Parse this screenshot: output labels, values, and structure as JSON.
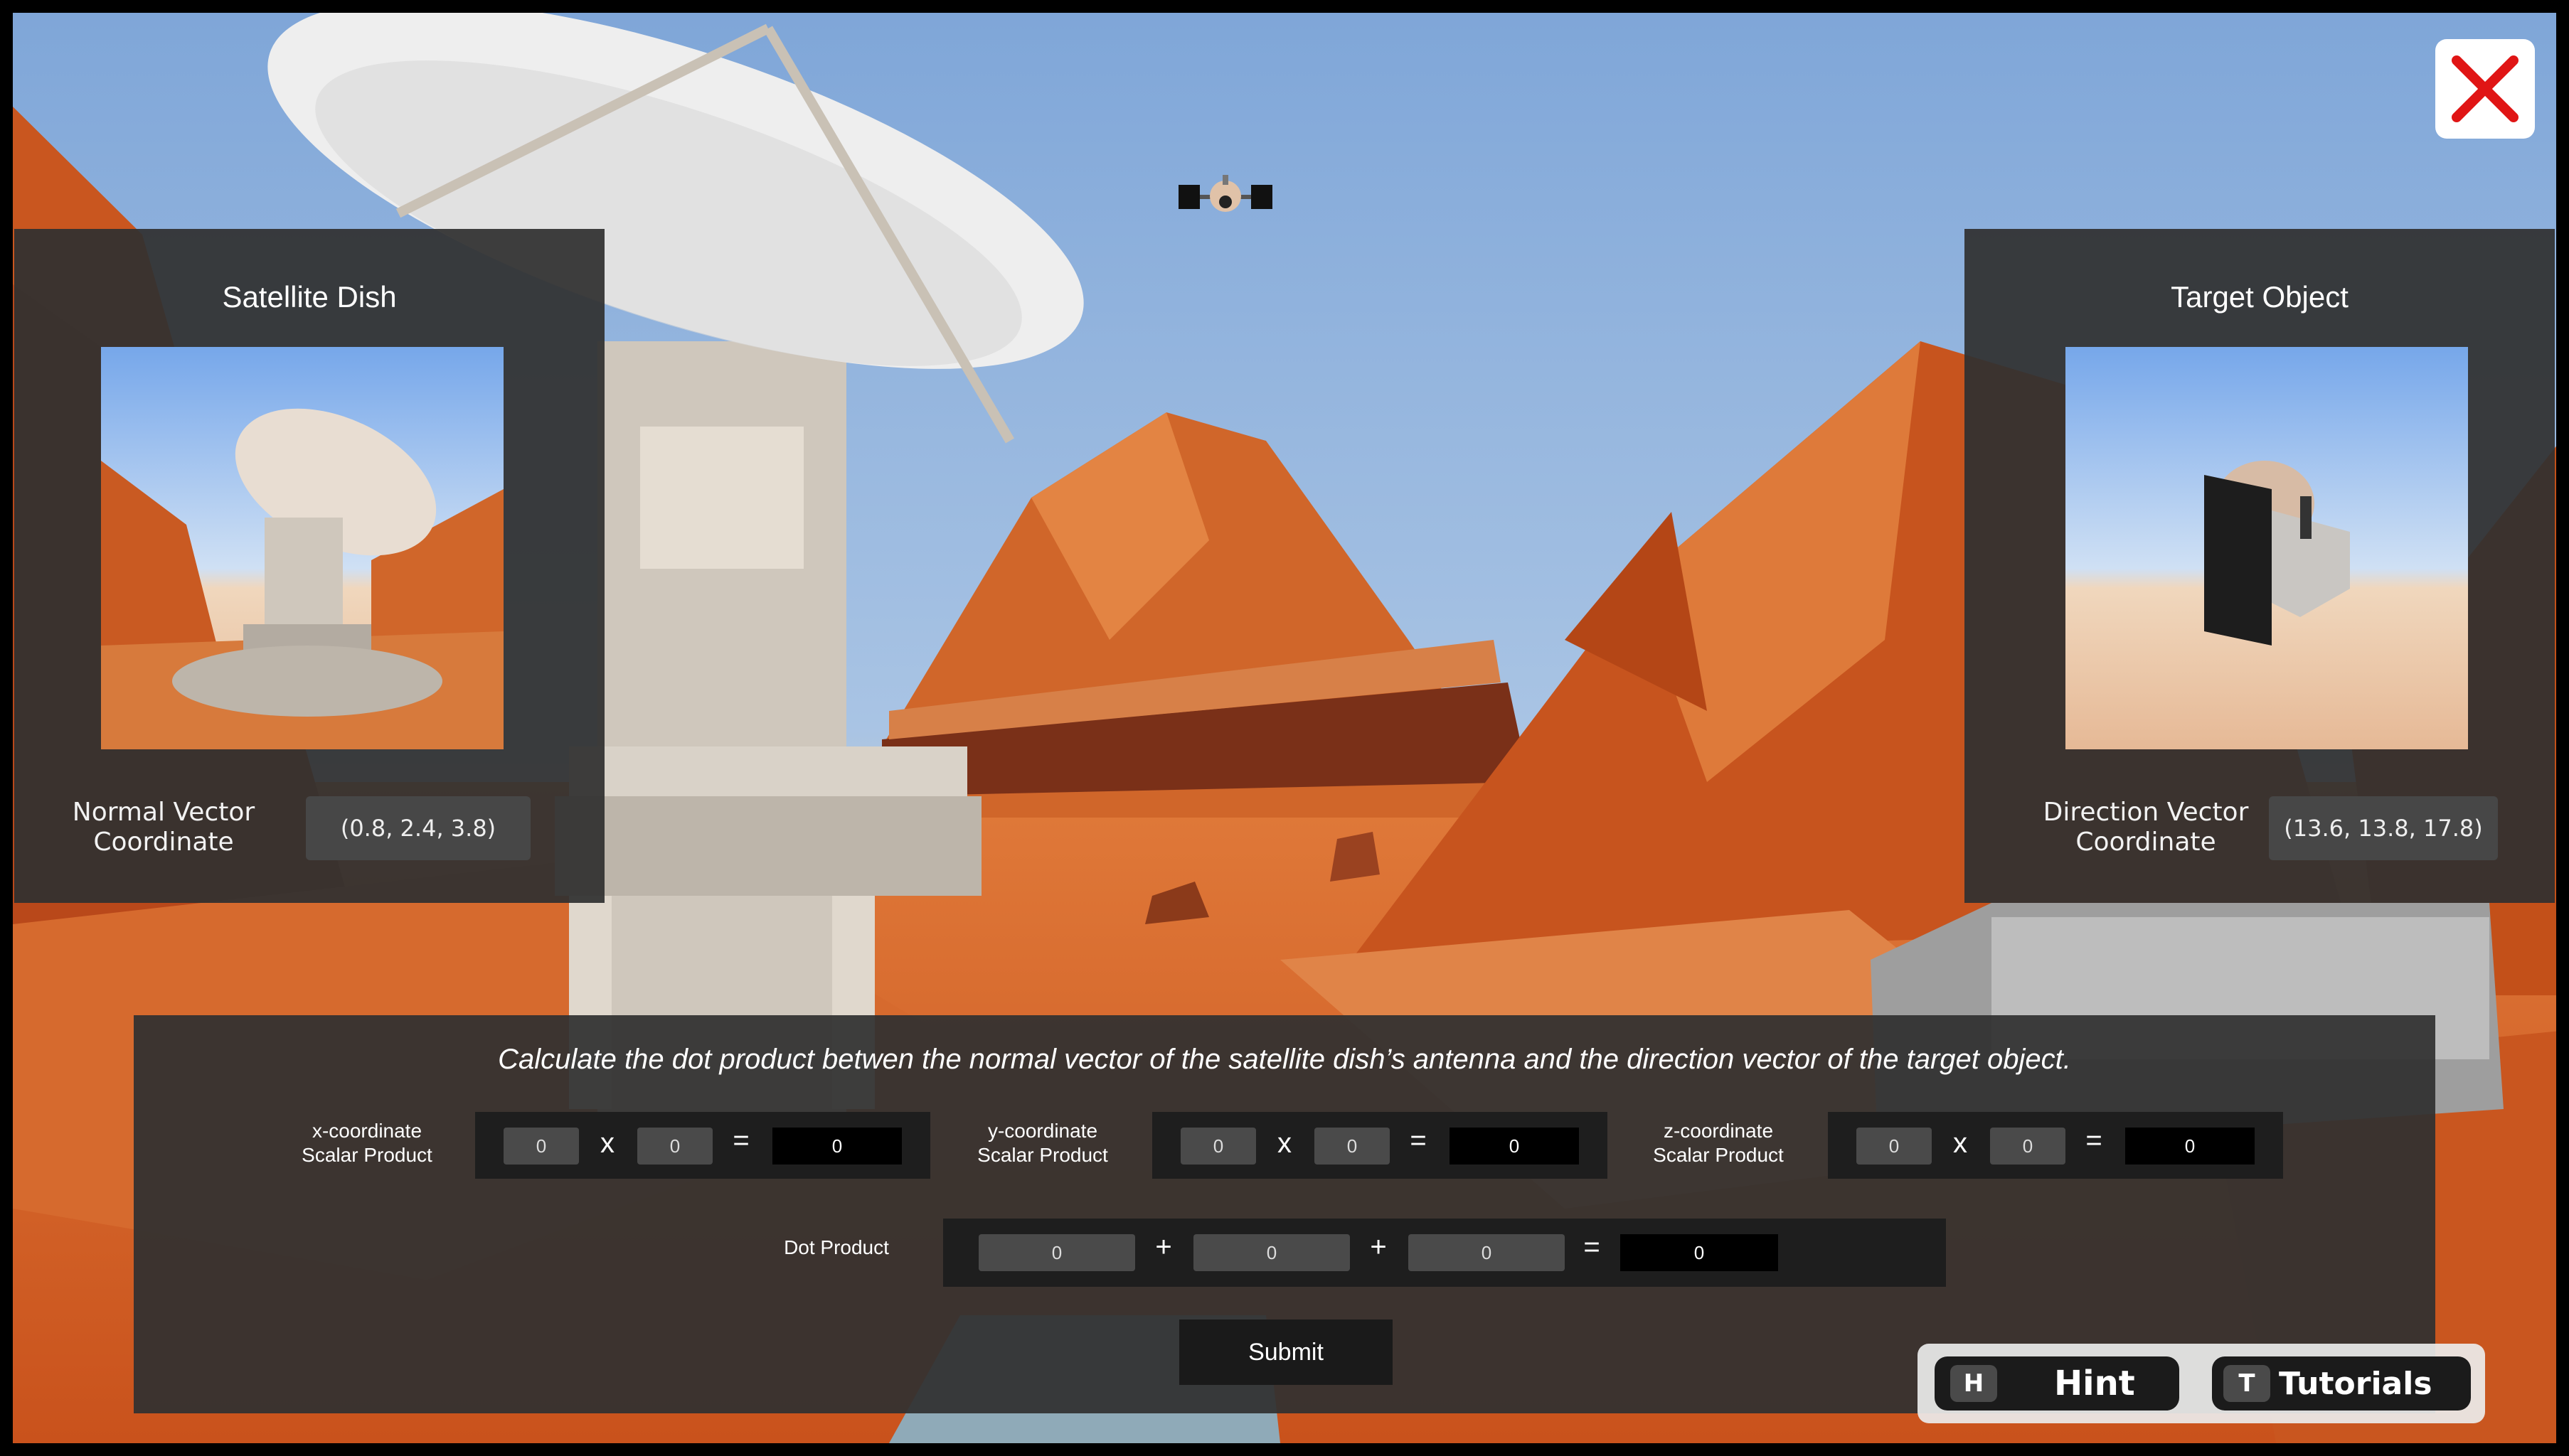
{
  "left_panel": {
    "title": "Satellite Dish",
    "vector_label_line1": "Normal Vector",
    "vector_label_line2": "Coordinate",
    "vector_value": "(0.8, 2.4, 3.8)"
  },
  "right_panel": {
    "title": "Target Object",
    "vector_label_line1": "Direction Vector",
    "vector_label_line2": "Coordinate",
    "vector_value": "(13.6, 13.8, 17.8)"
  },
  "question": {
    "text": "Calculate the dot product betwen the normal vector of the satellite dish’s antenna and the direction vector of the target object."
  },
  "scalar_rows": [
    {
      "label_line1": "x-coordinate",
      "label_line2": "Scalar Product",
      "a": "0",
      "b": "0",
      "result": "0"
    },
    {
      "label_line1": "y-coordinate",
      "label_line2": "Scalar Product",
      "a": "0",
      "b": "0",
      "result": "0"
    },
    {
      "label_line1": "z-coordinate",
      "label_line2": "Scalar Product",
      "a": "0",
      "b": "0",
      "result": "0"
    }
  ],
  "operators": {
    "times": "x",
    "equals": "=",
    "plus": "+"
  },
  "dot_product": {
    "label": "Dot Product",
    "terms": [
      "0",
      "0",
      "0"
    ],
    "result": "0"
  },
  "submit_label": "Submit",
  "hint": {
    "key": "H",
    "label": "Hint"
  },
  "tutorials": {
    "key": "T",
    "label": "Tutorials"
  },
  "icons": {
    "close": "close-icon",
    "satellite": "satellite-icon"
  },
  "colors": {
    "close_x": "#e01515",
    "panel": "#303030",
    "sand": "#d8642a"
  }
}
